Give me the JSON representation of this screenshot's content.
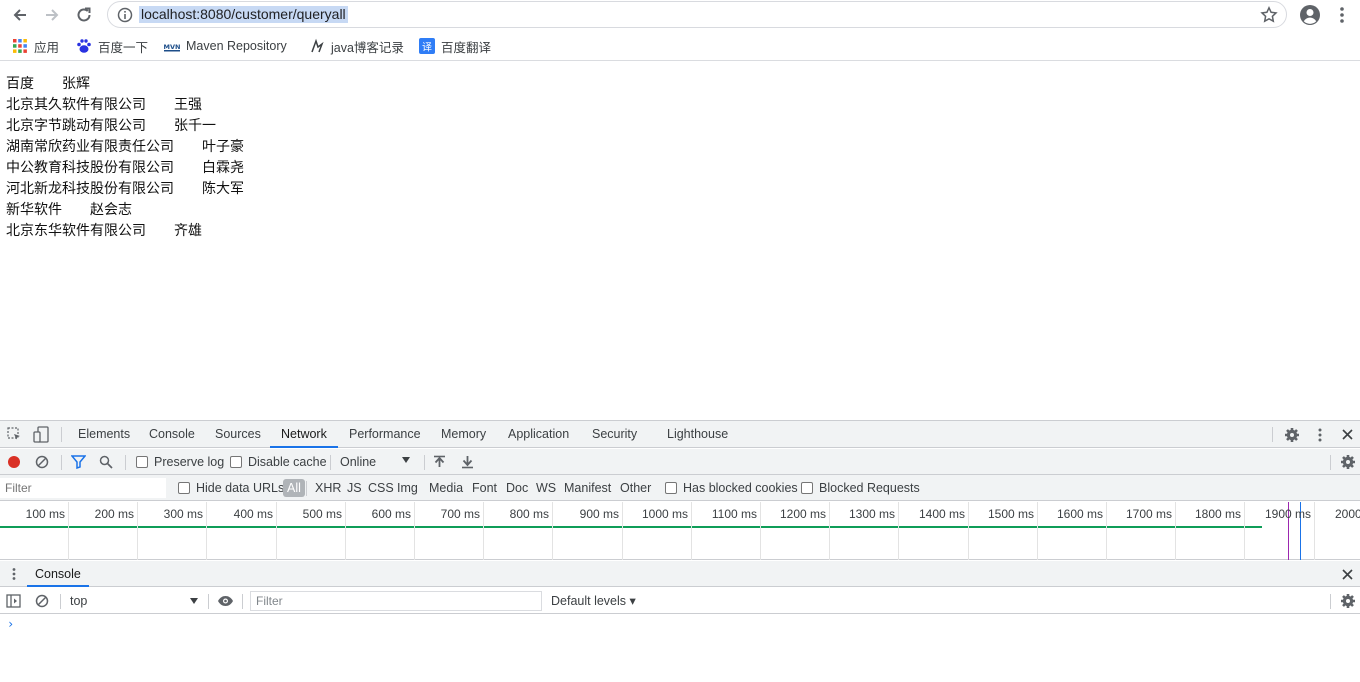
{
  "browser": {
    "url": "localhost:8080/customer/queryall",
    "bookmarks": [
      {
        "label": "应用",
        "icon": "apps-grid-icon"
      },
      {
        "label": "百度一下",
        "icon": "baidu-paw-icon"
      },
      {
        "label": "Maven Repository",
        "icon": "mvn-icon"
      },
      {
        "label": "java博客记录",
        "icon": "bookmark-bird-icon"
      },
      {
        "label": "百度翻译",
        "icon": "baidu-translate-icon"
      }
    ]
  },
  "page": {
    "rows": [
      {
        "company": "百度",
        "name": "张辉"
      },
      {
        "company": "北京其久软件有限公司",
        "name": "王强"
      },
      {
        "company": "北京字节跳动有限公司",
        "name": "张千一"
      },
      {
        "company": "湖南常欣药业有限责任公司",
        "name": "叶子豪"
      },
      {
        "company": "中公教育科技股份有限公司",
        "name": "白霖尧"
      },
      {
        "company": "河北新龙科技股份有限公司",
        "name": "陈大军"
      },
      {
        "company": "新华软件",
        "name": "赵会志"
      },
      {
        "company": "北京东华软件有限公司",
        "name": "齐雄"
      }
    ]
  },
  "devtools": {
    "tabs": [
      "Elements",
      "Console",
      "Sources",
      "Network",
      "Performance",
      "Memory",
      "Application",
      "Security",
      "Lighthouse"
    ],
    "active_tab": "Network",
    "toolbar": {
      "preserve_log": "Preserve log",
      "disable_cache": "Disable cache",
      "throttle": "Online"
    },
    "filterbar": {
      "filter_placeholder": "Filter",
      "hide_data_urls": "Hide data URLs",
      "types": [
        "All",
        "XHR",
        "JS",
        "CSS",
        "Img",
        "Media",
        "Font",
        "Doc",
        "WS",
        "Manifest",
        "Other"
      ],
      "has_blocked_cookies": "Has blocked cookies",
      "blocked_requests": "Blocked Requests"
    },
    "timeline_ticks": [
      "100 ms",
      "200 ms",
      "300 ms",
      "400 ms",
      "500 ms",
      "600 ms",
      "700 ms",
      "800 ms",
      "900 ms",
      "1000 ms",
      "1100 ms",
      "1200 ms",
      "1300 ms",
      "1400 ms",
      "1500 ms",
      "1600 ms",
      "1700 ms",
      "1800 ms",
      "1900 ms",
      "2000"
    ],
    "drawer": {
      "tab": "Console",
      "context": "top",
      "filter_placeholder": "Filter",
      "levels": "Default levels ▾",
      "prompt": "›"
    },
    "colors": {
      "accent": "#1a73e8",
      "record": "#d93025",
      "timeline_line": "#0f9d58"
    }
  }
}
